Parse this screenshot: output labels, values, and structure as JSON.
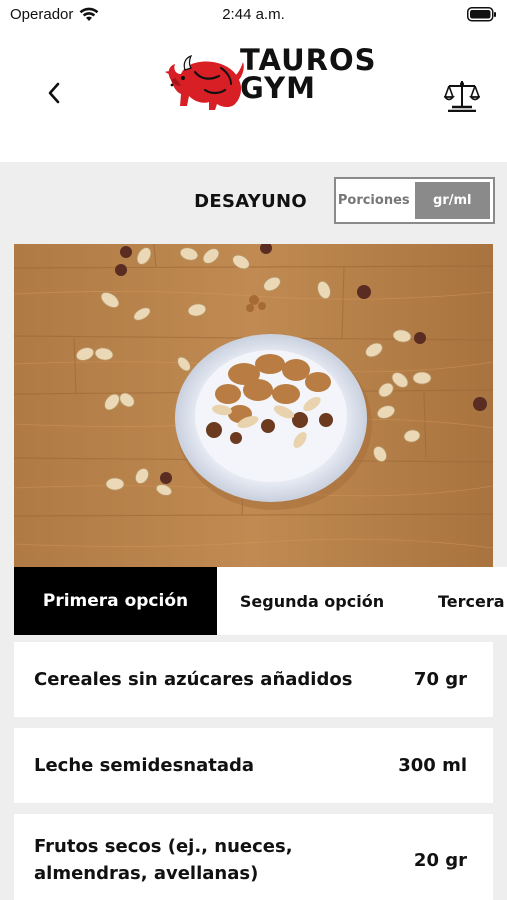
{
  "status_bar": {
    "carrier": "Operador",
    "time": "2:44 a.m."
  },
  "header": {
    "logo_line1": "TAUROS",
    "logo_line2": "GYM"
  },
  "meal": {
    "title": "DESAYUNO",
    "unit_options": [
      "Porciones",
      "gr/ml"
    ],
    "selected_unit": "gr/ml"
  },
  "tabs": [
    "Primera opción",
    "Segunda opción",
    "Tercera opción"
  ],
  "items": [
    {
      "name": "Cereales sin azúcares añadidos",
      "quantity": "70 gr"
    },
    {
      "name": "Leche semidesnatada",
      "quantity": "300 ml"
    },
    {
      "name": "Frutos secos (ej., nueces, almendras, avellanas)",
      "quantity": "20 gr"
    }
  ],
  "colors": {
    "accent": "#000000",
    "toggle_active": "#8a8a8a",
    "background": "#eeeeee",
    "logo_red": "#d81f26"
  }
}
